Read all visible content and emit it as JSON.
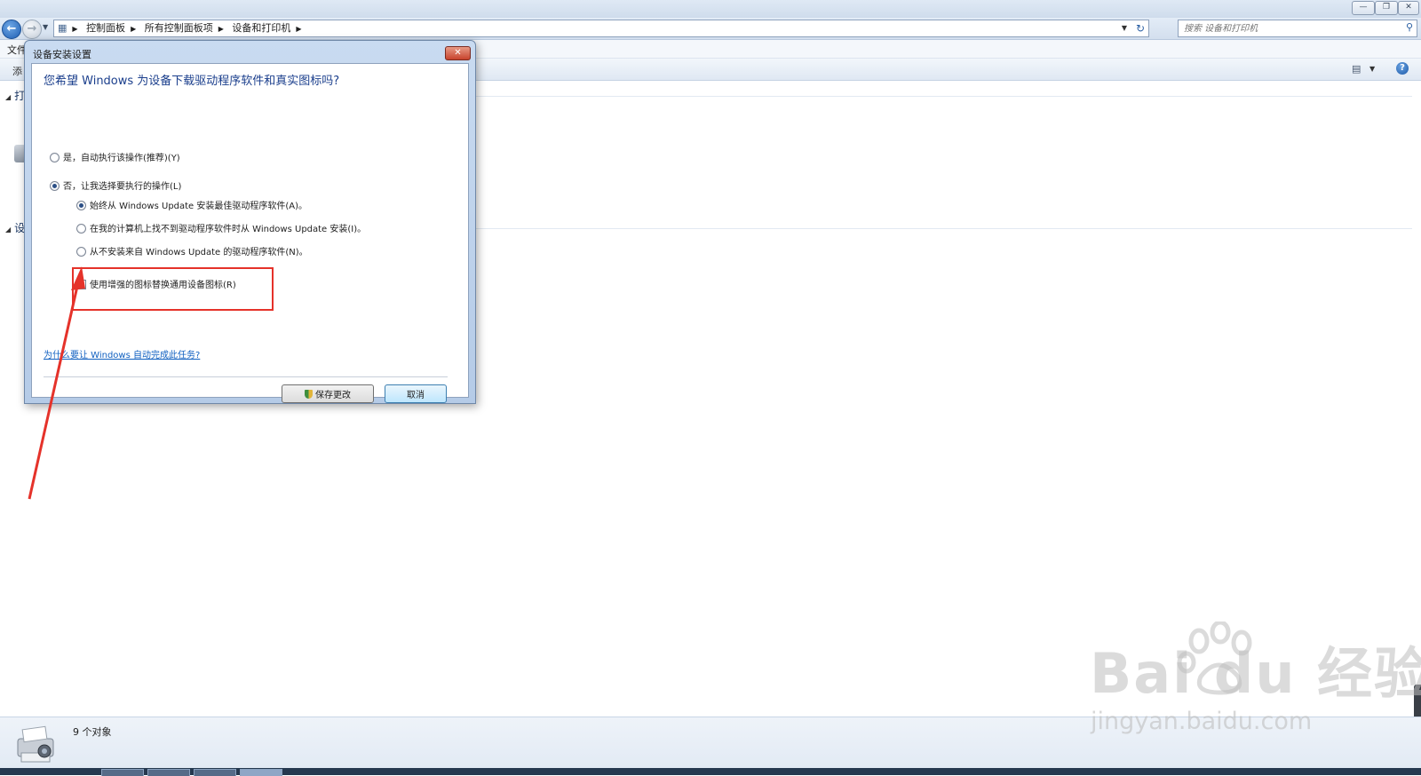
{
  "window": {
    "caption_buttons": [
      "minimize",
      "restore",
      "close"
    ]
  },
  "address_bar": {
    "breadcrumbs": [
      "控制面板",
      "所有控制面板项",
      "设备和打印机"
    ]
  },
  "search": {
    "placeholder": "搜索 设备和打印机"
  },
  "menu": {
    "file": "文件"
  },
  "command_bar": {
    "add_truncated": "添"
  },
  "groups": {
    "printers_truncated": "打",
    "devices_truncated": "设"
  },
  "status": {
    "object_count": "9 个对象"
  },
  "dialog": {
    "title": "设备安装设置",
    "question": "您希望 Windows 为设备下载驱动程序软件和真实图标吗?",
    "option_yes": "是，自动执行该操作(推荐)(Y)",
    "option_no": "否，让我选择要执行的操作(L)",
    "suboption_always": "始终从 Windows Update 安装最佳驱动程序软件(A)。",
    "suboption_if_not_found": "在我的计算机上找不到驱动程序软件时从 Windows Update 安装(I)。",
    "suboption_never": "从不安装来自 Windows Update 的驱动程序软件(N)。",
    "checkbox_enhanced_icons": "使用增强的图标替换通用设备图标(R)",
    "checkbox_checked": true,
    "selected_option": "option_no",
    "selected_suboption": "suboption_always",
    "why_link": "为什么要让 Windows 自动完成此任务?",
    "save_button": "保存更改",
    "cancel_button": "取消"
  },
  "watermark": {
    "line1": "Bai du 经验",
    "line2": "jingyan.baidu.com"
  },
  "colors": {
    "annotation_red": "#e5322a",
    "link_blue": "#0f5fc0",
    "question_blue": "#1a3e8c"
  }
}
